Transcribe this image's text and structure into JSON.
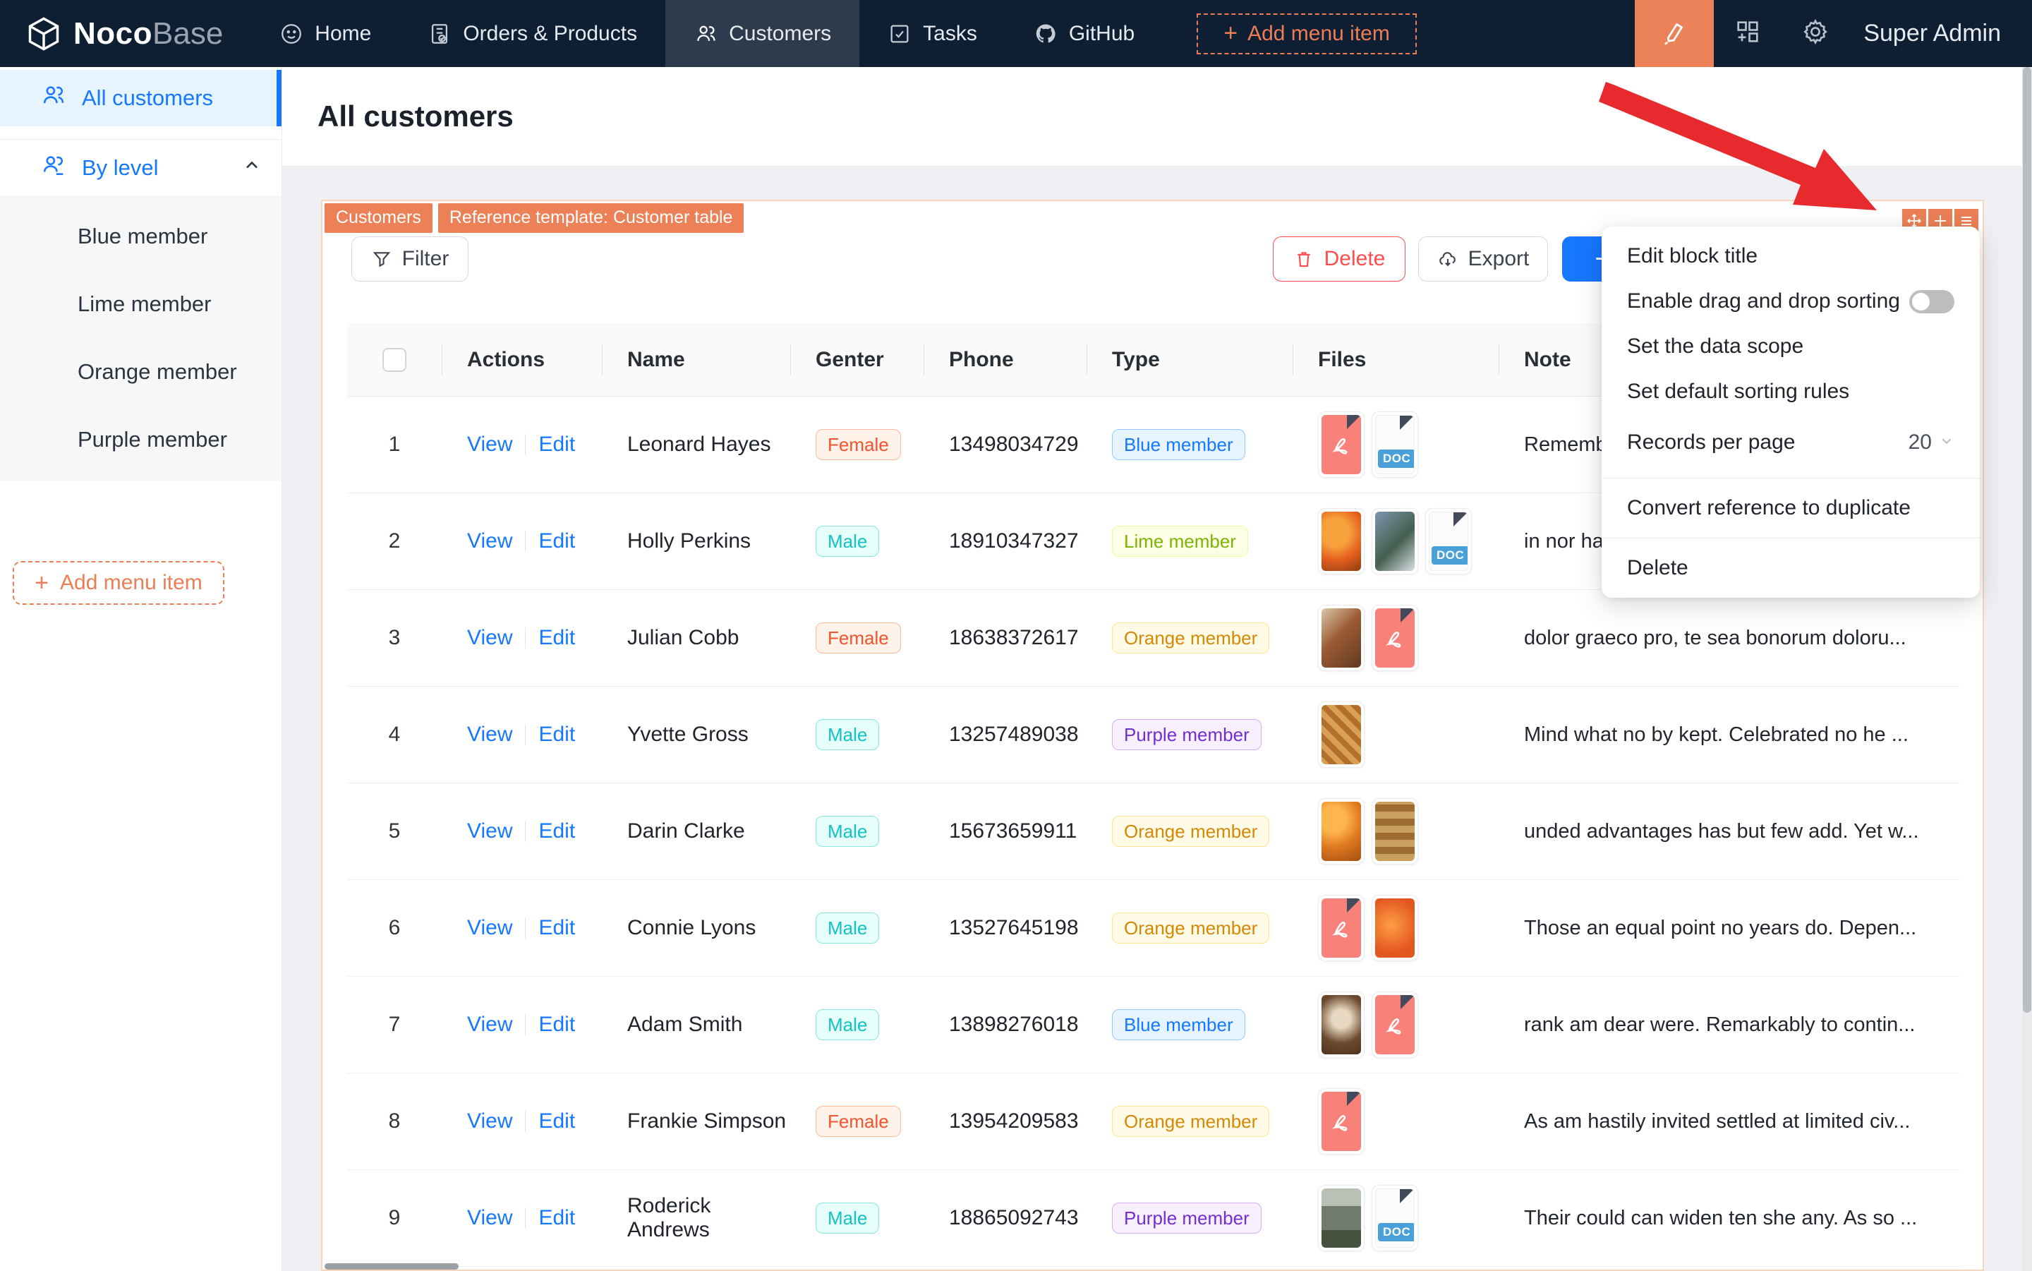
{
  "colors": {
    "navbar_bg": "#0e1e33",
    "accent_orange": "#ec8057",
    "primary_blue": "#1677ff",
    "danger_red": "#ff4d4f"
  },
  "navbar": {
    "brand": {
      "noco": "Noco",
      "base": "Base"
    },
    "items": [
      {
        "label": "Home"
      },
      {
        "label": "Orders & Products"
      },
      {
        "label": "Customers",
        "active": true
      },
      {
        "label": "Tasks"
      },
      {
        "label": "GitHub"
      }
    ],
    "add_menu_item": "Add menu item",
    "user": "Super Admin"
  },
  "sidebar": {
    "items": [
      {
        "label": "All customers",
        "active": true
      },
      {
        "label": "By level",
        "expanded": true
      }
    ],
    "sub_items": [
      "Blue member",
      "Lime member",
      "Orange member",
      "Purple member"
    ],
    "add_menu_item": "Add menu item"
  },
  "page": {
    "title": "All customers"
  },
  "block": {
    "tags": [
      "Customers",
      "Reference template: Customer table"
    ],
    "toolbar": {
      "filter": "Filter",
      "delete": "Delete",
      "export": "Export",
      "add": "+"
    }
  },
  "menu": {
    "items": [
      {
        "label": "Edit block title"
      },
      {
        "label": "Enable drag and drop sorting",
        "control": "toggle-off"
      },
      {
        "label": "Set the data scope"
      },
      {
        "label": "Set default sorting rules"
      },
      {
        "label": "Records per page",
        "value": "20"
      },
      {
        "label": "Convert reference to duplicate"
      },
      {
        "label": "Delete"
      }
    ],
    "records_per_page_value": "20"
  },
  "table": {
    "columns": [
      "Actions",
      "Name",
      "Genter",
      "Phone",
      "Type",
      "Files",
      "Note"
    ],
    "action_labels": [
      "View",
      "Edit"
    ],
    "rows": [
      {
        "index": "1",
        "name": "Leonard Hayes",
        "gender": "Female",
        "gender_color": "volcano",
        "phone": "13498034729",
        "type": "Blue member",
        "type_color": "blue",
        "files": [
          {
            "kind": "pdf"
          },
          {
            "kind": "doc"
          }
        ],
        "note": "Remember"
      },
      {
        "index": "2",
        "name": "Holly Perkins",
        "gender": "Male",
        "gender_color": "cyan",
        "phone": "18910347327",
        "type": "Lime member",
        "type_color": "lime",
        "files": [
          {
            "kind": "image",
            "variant": "oranges"
          },
          {
            "kind": "image",
            "variant": "berries"
          },
          {
            "kind": "doc"
          }
        ],
        "note": "in nor ham"
      },
      {
        "index": "3",
        "name": "Julian Cobb",
        "gender": "Female",
        "gender_color": "volcano",
        "phone": "18638372617",
        "type": "Orange member",
        "type_color": "orange",
        "files": [
          {
            "kind": "image",
            "variant": "platter"
          },
          {
            "kind": "pdf"
          }
        ],
        "note": "dolor graeco pro, te sea bonorum doloru..."
      },
      {
        "index": "4",
        "name": "Yvette Gross",
        "gender": "Male",
        "gender_color": "cyan",
        "phone": "13257489038",
        "type": "Purple member",
        "type_color": "purple",
        "files": [
          {
            "kind": "image",
            "variant": "pastry"
          }
        ],
        "note": "Mind what no by kept. Celebrated no he ..."
      },
      {
        "index": "5",
        "name": "Darin Clarke",
        "gender": "Male",
        "gender_color": "cyan",
        "phone": "15673659911",
        "type": "Orange member",
        "type_color": "orange",
        "files": [
          {
            "kind": "image",
            "variant": "oranges2"
          },
          {
            "kind": "image",
            "variant": "pastry2"
          }
        ],
        "note": "unded advantages has but few add. Yet w..."
      },
      {
        "index": "6",
        "name": "Connie Lyons",
        "gender": "Male",
        "gender_color": "cyan",
        "phone": "13527645198",
        "type": "Orange member",
        "type_color": "orange",
        "files": [
          {
            "kind": "pdf"
          },
          {
            "kind": "image",
            "variant": "orangefruit"
          }
        ],
        "note": "Those an equal point no years do. Depen..."
      },
      {
        "index": "7",
        "name": "Adam Smith",
        "gender": "Male",
        "gender_color": "cyan",
        "phone": "13898276018",
        "type": "Blue member",
        "type_color": "blue",
        "files": [
          {
            "kind": "image",
            "variant": "coffee"
          },
          {
            "kind": "pdf"
          }
        ],
        "note": "rank am dear were. Remarkably to contin..."
      },
      {
        "index": "8",
        "name": "Frankie Simpson",
        "gender": "Female",
        "gender_color": "volcano",
        "phone": "13954209583",
        "type": "Orange member",
        "type_color": "orange",
        "files": [
          {
            "kind": "pdf"
          }
        ],
        "note": "As am hastily invited settled at limited civ..."
      },
      {
        "index": "9",
        "name": "Roderick Andrews",
        "gender": "Male",
        "gender_color": "cyan",
        "phone": "18865092743",
        "type": "Purple member",
        "type_color": "purple",
        "files": [
          {
            "kind": "image",
            "variant": "storefront"
          },
          {
            "kind": "doc"
          }
        ],
        "note": "Their could can widen ten she any. As so ..."
      }
    ]
  }
}
